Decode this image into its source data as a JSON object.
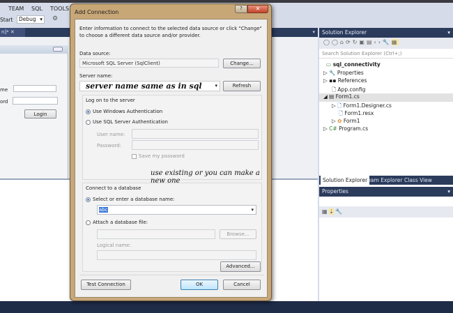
{
  "menu": {
    "items": [
      "TEAM",
      "SQL",
      "TOOLS"
    ]
  },
  "toolbar": {
    "start_label": "Start",
    "config": "Debug"
  },
  "doc_tab": {
    "label": "n]*"
  },
  "form": {
    "username_label": "me",
    "password_label": "ord",
    "login_button": "Login"
  },
  "dialog": {
    "title": "Add Connection",
    "intro": "Enter information to connect to the selected data source or click \"Change\" to choose a different data source and/or provider.",
    "data_source_label": "Data source:",
    "data_source_value": "Microsoft SQL Server (SqlClient)",
    "change_button": "Change...",
    "server_name_label": "Server name:",
    "server_name_value": "server name same as in sql",
    "refresh_button": "Refresh",
    "logon_group": "Log on to the server",
    "windows_auth": "Use Windows Authentication",
    "sql_auth": "Use SQL Server Authentication",
    "user_name_label": "User name:",
    "password_label": "Password:",
    "save_password": "Save my password",
    "db_group": "Connect to a database",
    "select_db": "Select or enter a database name:",
    "db_value": "abc",
    "attach_db": "Attach a database file:",
    "browse_button": "Browse...",
    "logical_name_label": "Logical name:",
    "advanced_button": "Advanced...",
    "test_button": "Test Connection",
    "ok_button": "OK",
    "cancel_button": "Cancel",
    "annotation": "use existing or you can make a new one"
  },
  "solution_explorer": {
    "title": "Solution Explorer",
    "search_placeholder": "Search Solution Explorer (Ctrl+;)",
    "items": [
      {
        "label": "sql_connectivity"
      },
      {
        "label": "Properties"
      },
      {
        "label": "References"
      },
      {
        "label": "App.config"
      },
      {
        "label": "Form1.cs"
      },
      {
        "label": "Form1.Designer.cs"
      },
      {
        "label": "Form1.resx"
      },
      {
        "label": "Form1"
      },
      {
        "label": "Program.cs"
      }
    ],
    "tabs": [
      "Solution Explorer",
      "Team Explorer",
      "Class View"
    ]
  },
  "properties": {
    "title": "Properties"
  }
}
